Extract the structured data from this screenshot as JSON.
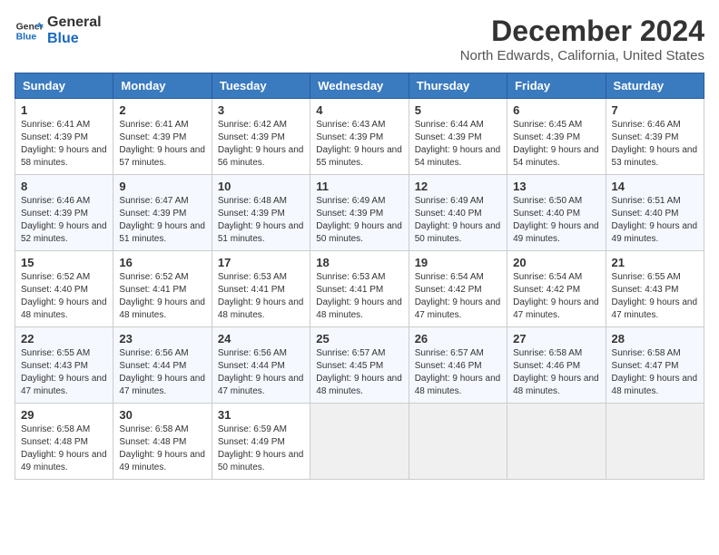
{
  "logo": {
    "text_general": "General",
    "text_blue": "Blue"
  },
  "title": "December 2024",
  "subtitle": "North Edwards, California, United States",
  "headers": [
    "Sunday",
    "Monday",
    "Tuesday",
    "Wednesday",
    "Thursday",
    "Friday",
    "Saturday"
  ],
  "weeks": [
    [
      {
        "day": "1",
        "sunrise": "6:41 AM",
        "sunset": "4:39 PM",
        "daylight": "9 hours and 58 minutes."
      },
      {
        "day": "2",
        "sunrise": "6:41 AM",
        "sunset": "4:39 PM",
        "daylight": "9 hours and 57 minutes."
      },
      {
        "day": "3",
        "sunrise": "6:42 AM",
        "sunset": "4:39 PM",
        "daylight": "9 hours and 56 minutes."
      },
      {
        "day": "4",
        "sunrise": "6:43 AM",
        "sunset": "4:39 PM",
        "daylight": "9 hours and 55 minutes."
      },
      {
        "day": "5",
        "sunrise": "6:44 AM",
        "sunset": "4:39 PM",
        "daylight": "9 hours and 54 minutes."
      },
      {
        "day": "6",
        "sunrise": "6:45 AM",
        "sunset": "4:39 PM",
        "daylight": "9 hours and 54 minutes."
      },
      {
        "day": "7",
        "sunrise": "6:46 AM",
        "sunset": "4:39 PM",
        "daylight": "9 hours and 53 minutes."
      }
    ],
    [
      {
        "day": "8",
        "sunrise": "6:46 AM",
        "sunset": "4:39 PM",
        "daylight": "9 hours and 52 minutes."
      },
      {
        "day": "9",
        "sunrise": "6:47 AM",
        "sunset": "4:39 PM",
        "daylight": "9 hours and 51 minutes."
      },
      {
        "day": "10",
        "sunrise": "6:48 AM",
        "sunset": "4:39 PM",
        "daylight": "9 hours and 51 minutes."
      },
      {
        "day": "11",
        "sunrise": "6:49 AM",
        "sunset": "4:39 PM",
        "daylight": "9 hours and 50 minutes."
      },
      {
        "day": "12",
        "sunrise": "6:49 AM",
        "sunset": "4:40 PM",
        "daylight": "9 hours and 50 minutes."
      },
      {
        "day": "13",
        "sunrise": "6:50 AM",
        "sunset": "4:40 PM",
        "daylight": "9 hours and 49 minutes."
      },
      {
        "day": "14",
        "sunrise": "6:51 AM",
        "sunset": "4:40 PM",
        "daylight": "9 hours and 49 minutes."
      }
    ],
    [
      {
        "day": "15",
        "sunrise": "6:52 AM",
        "sunset": "4:40 PM",
        "daylight": "9 hours and 48 minutes."
      },
      {
        "day": "16",
        "sunrise": "6:52 AM",
        "sunset": "4:41 PM",
        "daylight": "9 hours and 48 minutes."
      },
      {
        "day": "17",
        "sunrise": "6:53 AM",
        "sunset": "4:41 PM",
        "daylight": "9 hours and 48 minutes."
      },
      {
        "day": "18",
        "sunrise": "6:53 AM",
        "sunset": "4:41 PM",
        "daylight": "9 hours and 48 minutes."
      },
      {
        "day": "19",
        "sunrise": "6:54 AM",
        "sunset": "4:42 PM",
        "daylight": "9 hours and 47 minutes."
      },
      {
        "day": "20",
        "sunrise": "6:54 AM",
        "sunset": "4:42 PM",
        "daylight": "9 hours and 47 minutes."
      },
      {
        "day": "21",
        "sunrise": "6:55 AM",
        "sunset": "4:43 PM",
        "daylight": "9 hours and 47 minutes."
      }
    ],
    [
      {
        "day": "22",
        "sunrise": "6:55 AM",
        "sunset": "4:43 PM",
        "daylight": "9 hours and 47 minutes."
      },
      {
        "day": "23",
        "sunrise": "6:56 AM",
        "sunset": "4:44 PM",
        "daylight": "9 hours and 47 minutes."
      },
      {
        "day": "24",
        "sunrise": "6:56 AM",
        "sunset": "4:44 PM",
        "daylight": "9 hours and 47 minutes."
      },
      {
        "day": "25",
        "sunrise": "6:57 AM",
        "sunset": "4:45 PM",
        "daylight": "9 hours and 48 minutes."
      },
      {
        "day": "26",
        "sunrise": "6:57 AM",
        "sunset": "4:46 PM",
        "daylight": "9 hours and 48 minutes."
      },
      {
        "day": "27",
        "sunrise": "6:58 AM",
        "sunset": "4:46 PM",
        "daylight": "9 hours and 48 minutes."
      },
      {
        "day": "28",
        "sunrise": "6:58 AM",
        "sunset": "4:47 PM",
        "daylight": "9 hours and 48 minutes."
      }
    ],
    [
      {
        "day": "29",
        "sunrise": "6:58 AM",
        "sunset": "4:48 PM",
        "daylight": "9 hours and 49 minutes."
      },
      {
        "day": "30",
        "sunrise": "6:58 AM",
        "sunset": "4:48 PM",
        "daylight": "9 hours and 49 minutes."
      },
      {
        "day": "31",
        "sunrise": "6:59 AM",
        "sunset": "4:49 PM",
        "daylight": "9 hours and 50 minutes."
      },
      null,
      null,
      null,
      null
    ]
  ],
  "labels": {
    "sunrise": "Sunrise:",
    "sunset": "Sunset:",
    "daylight": "Daylight:"
  }
}
